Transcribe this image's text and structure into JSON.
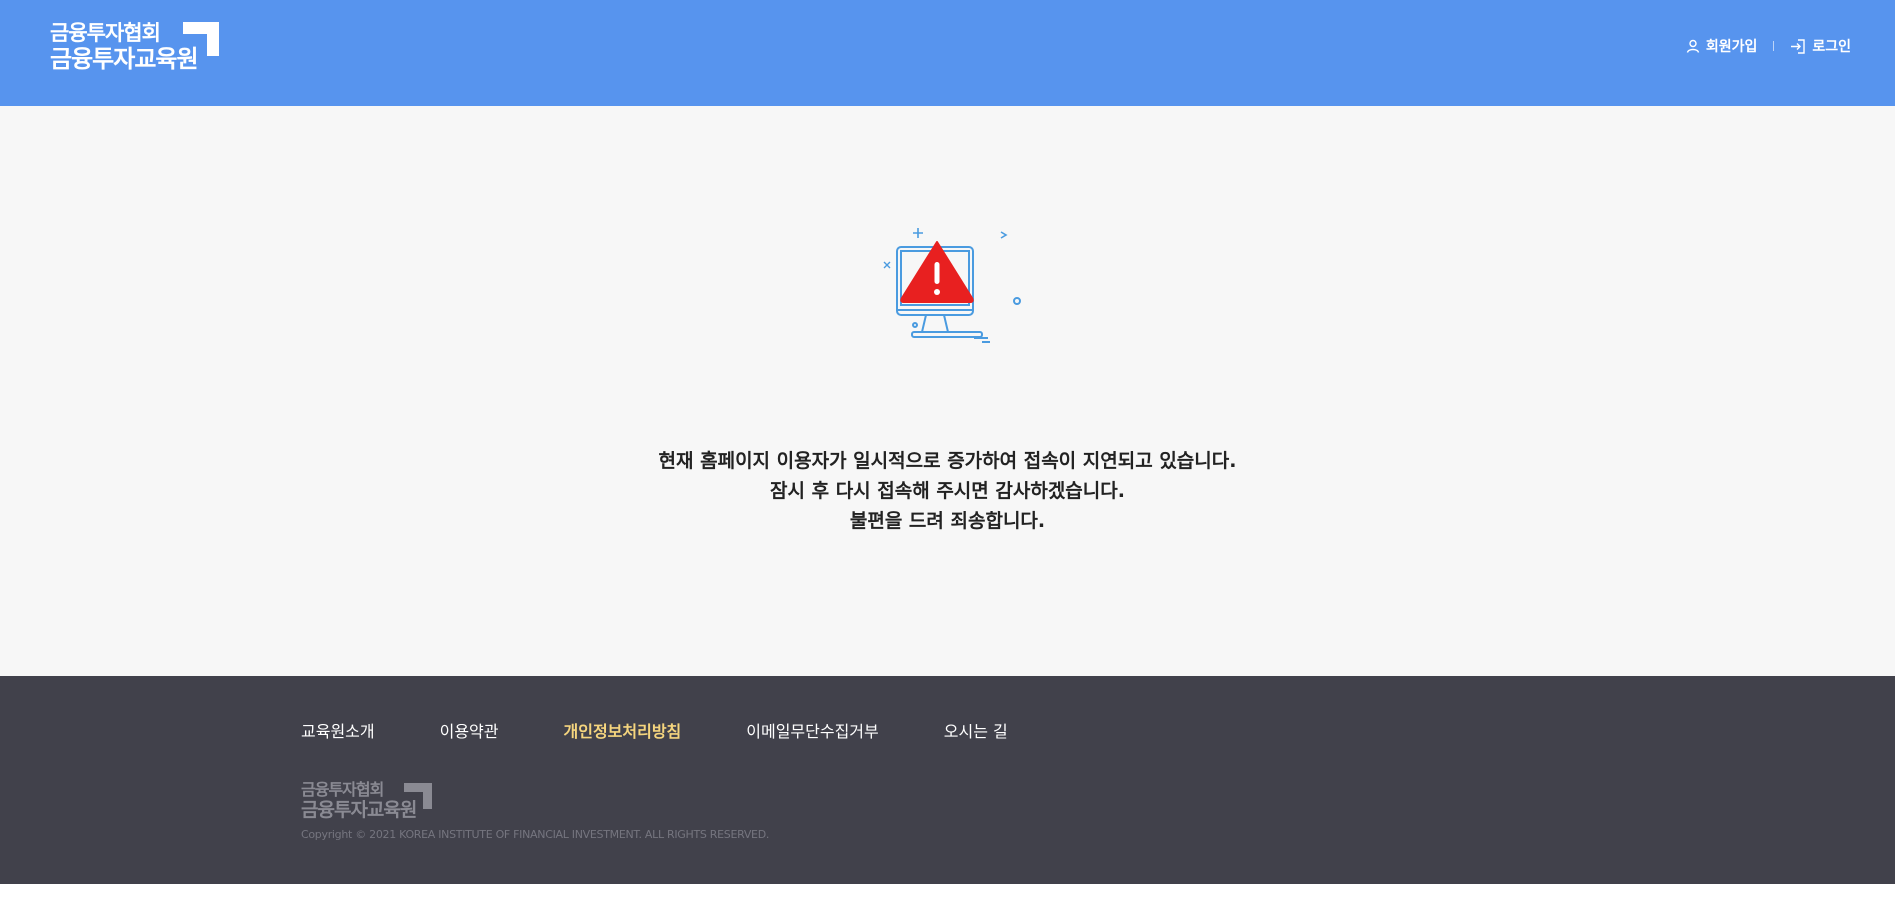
{
  "header": {
    "logo_line1": "금융투자협회",
    "logo_line2": "금융투자교육원",
    "signup_label": "회원가입",
    "login_label": "로그인"
  },
  "main": {
    "message_lines": [
      "현재 홈페이지 이용자가 일시적으로 증가하여 접속이 지연되고 있습니다.",
      "잠시 후 다시 접속해 주시면 감사하겠습니다.",
      "불편을 드려 죄송합니다."
    ]
  },
  "footer": {
    "links": [
      {
        "label": "교육원소개"
      },
      {
        "label": "이용약관"
      },
      {
        "label": "개인정보처리방침"
      },
      {
        "label": "이메일무단수집거부"
      },
      {
        "label": "오시는 길"
      }
    ],
    "logo_line1": "금융투자협회",
    "logo_line2": "금융투자교육원",
    "copyright": "Copyright © 2021 KOREA INSTITUTE OF FINANCIAL INVESTMENT. ALL RIGHTS RESERVED."
  },
  "colors": {
    "header_bg": "#5794ee",
    "footer_bg": "#41414b",
    "highlight_link": "#f5d57e",
    "warning_red": "#e82020",
    "monitor_blue": "#4a9be0"
  },
  "icons": {
    "user": "user-icon",
    "login": "login-icon",
    "monitor": "monitor-icon",
    "warning": "warning-icon"
  }
}
